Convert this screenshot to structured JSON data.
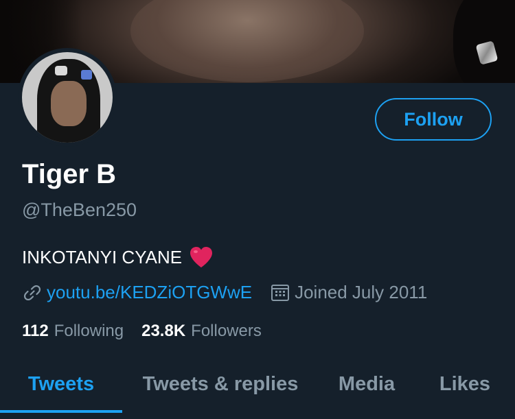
{
  "profile": {
    "name": "Tiger B",
    "handle": "@TheBen250",
    "bio": "INKOTANYI CYANE",
    "bio_emoji": "heart-emoji",
    "link": "youtu.be/KEDZiOTGWwE",
    "joined": "Joined July 2011"
  },
  "actions": {
    "follow_label": "Follow"
  },
  "stats": {
    "following_count": "112",
    "following_label": "Following",
    "followers_count": "23.8K",
    "followers_label": "Followers"
  },
  "tabs": [
    {
      "label": "Tweets",
      "active": true
    },
    {
      "label": "Tweets & replies",
      "active": false
    },
    {
      "label": "Media",
      "active": false
    },
    {
      "label": "Likes",
      "active": false
    }
  ],
  "colors": {
    "background": "#15202b",
    "accent": "#1da1f2",
    "secondary_text": "#8899a6",
    "heart": "#e0245e"
  },
  "icons": {
    "link": "link-icon",
    "calendar": "calendar-icon"
  }
}
